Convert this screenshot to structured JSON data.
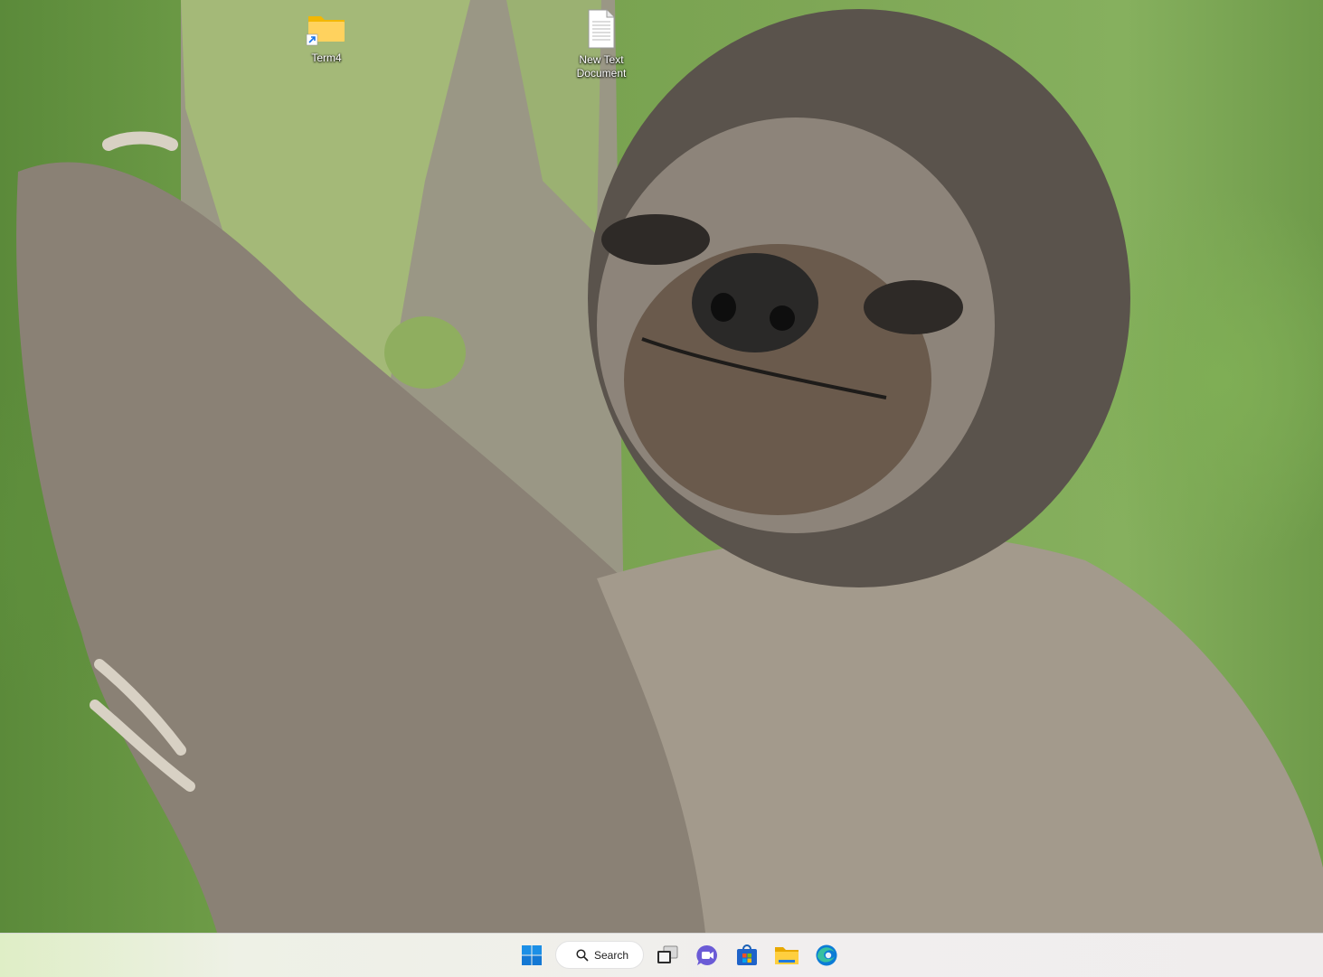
{
  "desktop": {
    "icons": [
      {
        "label": "Term4",
        "icon": "folder-shortcut-icon"
      },
      {
        "label": "New Text Document",
        "icon": "text-document-icon"
      }
    ]
  },
  "taskbar": {
    "start_icon": "windows-start-icon",
    "search": {
      "label": "Search",
      "icon": "search-icon"
    },
    "apps": [
      {
        "name": "Task View",
        "icon": "task-view-icon"
      },
      {
        "name": "Chat",
        "icon": "teams-chat-icon"
      },
      {
        "name": "Microsoft Store",
        "icon": "store-icon"
      },
      {
        "name": "File Explorer",
        "icon": "file-explorer-icon"
      },
      {
        "name": "Microsoft Edge",
        "icon": "edge-icon"
      }
    ],
    "colors": {
      "accent": "#0078d4",
      "folder": "#ffc83d"
    }
  }
}
